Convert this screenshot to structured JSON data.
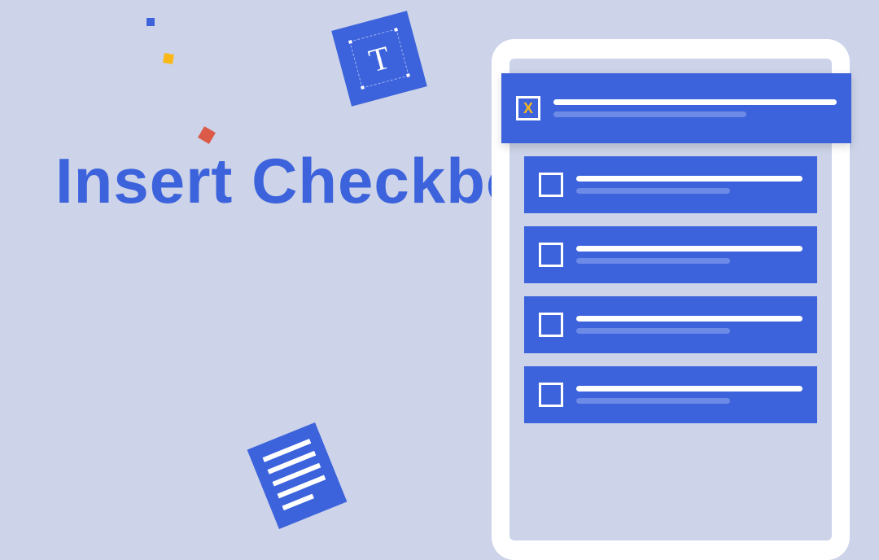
{
  "heading": "Insert Checkbox in Word",
  "t_tile_letter": "T",
  "checklist": {
    "items": [
      {
        "checked_mark": "X"
      },
      {
        "checked_mark": ""
      },
      {
        "checked_mark": ""
      },
      {
        "checked_mark": ""
      },
      {
        "checked_mark": ""
      }
    ]
  }
}
